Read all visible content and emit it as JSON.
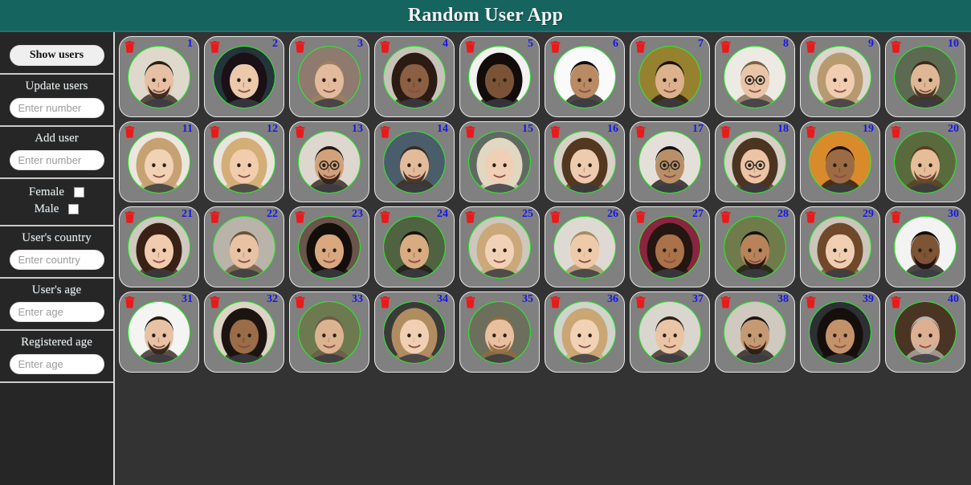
{
  "header": {
    "title": "Random User App"
  },
  "colors": {
    "header_bg": "#166460",
    "sidebar_bg": "#262626",
    "main_bg": "#333333",
    "card_bg": "#808080",
    "avatar_ring": "#18f018",
    "number": "#1616e8",
    "trash": "#e81a1a"
  },
  "sidebar": {
    "show_users_button": "Show users",
    "update_users": {
      "label": "Update users",
      "placeholder": "Enter number",
      "value": ""
    },
    "add_user": {
      "label": "Add user",
      "placeholder": "Enter number",
      "value": ""
    },
    "gender": {
      "female": {
        "label": "Female",
        "checked": false
      },
      "male": {
        "label": "Male",
        "checked": false
      }
    },
    "country": {
      "label": "User's country",
      "placeholder": "Enter country",
      "value": ""
    },
    "age": {
      "label": "User's age",
      "placeholder": "Enter age",
      "value": ""
    },
    "registered_age": {
      "label": "Registered age",
      "placeholder": "Enter age",
      "value": ""
    },
    "icons": {
      "delete": "trash-icon",
      "checkbox": "checkbox-icon"
    }
  },
  "main": {
    "columns": 10,
    "rows": 4,
    "total_users": 40,
    "users": [
      {
        "number": "1",
        "hair": "#2a1d14",
        "skin": "#e6c0a4",
        "bg": "#ded9cc",
        "facial": true,
        "glasses": false,
        "long": false
      },
      {
        "number": "2",
        "hair": "#1a1016",
        "skin": "#ecc9ab",
        "bg": "#24343a",
        "facial": false,
        "glasses": false,
        "long": true
      },
      {
        "number": "3",
        "hair": "#9e8260",
        "skin": "#e3bb9c",
        "bg": "#8e7a6e",
        "facial": false,
        "glasses": false,
        "long": false
      },
      {
        "number": "4",
        "hair": "#2b1b12",
        "skin": "#8a5f42",
        "bg": "#c8c3b8",
        "facial": false,
        "glasses": false,
        "long": true
      },
      {
        "number": "5",
        "hair": "#120d0a",
        "skin": "#7a5337",
        "bg": "#f2f2f2",
        "facial": false,
        "glasses": false,
        "long": true
      },
      {
        "number": "6",
        "hair": "#110c09",
        "skin": "#b98a63",
        "bg": "#fafafa",
        "facial": false,
        "glasses": false,
        "long": false
      },
      {
        "number": "7",
        "hair": "#1a1210",
        "skin": "#dcb18c",
        "bg": "#96812f",
        "facial": false,
        "glasses": false,
        "long": false
      },
      {
        "number": "8",
        "hair": "#7b6046",
        "skin": "#e9c4a6",
        "bg": "#eceae3",
        "facial": false,
        "glasses": true,
        "long": false
      },
      {
        "number": "9",
        "hair": "#b79a6f",
        "skin": "#f0cdb1",
        "bg": "#ddd6cf",
        "facial": false,
        "glasses": false,
        "long": true
      },
      {
        "number": "10",
        "hair": "#3a2a1c",
        "skin": "#dfb795",
        "bg": "#5c6a52",
        "facial": true,
        "glasses": false,
        "long": false
      },
      {
        "number": "11",
        "hair": "#c6a273",
        "skin": "#f2d2b5",
        "bg": "#ece6df",
        "facial": false,
        "glasses": false,
        "long": true
      },
      {
        "number": "12",
        "hair": "#d3ae76",
        "skin": "#f1cdae",
        "bg": "#e9e4dd",
        "facial": false,
        "glasses": false,
        "long": true
      },
      {
        "number": "13",
        "hair": "#231812",
        "skin": "#d2a179",
        "bg": "#ddd7cf",
        "facial": true,
        "glasses": true,
        "long": false
      },
      {
        "number": "14",
        "hair": "#3b2a1e",
        "skin": "#e2bb9a",
        "bg": "#4a5d6b",
        "facial": true,
        "glasses": false,
        "long": false
      },
      {
        "number": "15",
        "hair": "#e2d7c0",
        "skin": "#f0cfb5",
        "bg": "#5f6a62",
        "facial": false,
        "glasses": false,
        "long": true
      },
      {
        "number": "16",
        "hair": "#53371f",
        "skin": "#eecbae",
        "bg": "#d8d1c8",
        "facial": false,
        "glasses": false,
        "long": true
      },
      {
        "number": "17",
        "hair": "#130e0b",
        "skin": "#b98f67",
        "bg": "#e4e0d9",
        "facial": false,
        "glasses": true,
        "long": false
      },
      {
        "number": "18",
        "hair": "#4b3420",
        "skin": "#ecc4a4",
        "bg": "#d6d0c7",
        "facial": false,
        "glasses": true,
        "long": true
      },
      {
        "number": "19",
        "hair": "#191110",
        "skin": "#9d6b43",
        "bg": "#d98a2a",
        "facial": false,
        "glasses": false,
        "long": false
      },
      {
        "number": "20",
        "hair": "#5a3c22",
        "skin": "#e6bd99",
        "bg": "#596b3c",
        "facial": true,
        "glasses": false,
        "long": false
      },
      {
        "number": "21",
        "hair": "#3a2115",
        "skin": "#f0cbae",
        "bg": "#cfc9bf",
        "facial": false,
        "glasses": false,
        "long": true
      },
      {
        "number": "22",
        "hair": "#6a5338",
        "skin": "#e8c2a2",
        "bg": "#b9b3aa",
        "facial": false,
        "glasses": false,
        "long": false
      },
      {
        "number": "23",
        "hair": "#140e0b",
        "skin": "#d9a87f",
        "bg": "#6a544c",
        "facial": false,
        "glasses": false,
        "long": true
      },
      {
        "number": "24",
        "hair": "#171010",
        "skin": "#d9ab80",
        "bg": "#4f6340",
        "facial": false,
        "glasses": false,
        "long": false
      },
      {
        "number": "25",
        "hair": "#caa87a",
        "skin": "#f2d2b6",
        "bg": "#cdc7bd",
        "facial": false,
        "glasses": false,
        "long": true
      },
      {
        "number": "26",
        "hair": "#a78a5e",
        "skin": "#eec9aa",
        "bg": "#dedad3",
        "facial": false,
        "glasses": false,
        "long": false
      },
      {
        "number": "27",
        "hair": "#241610",
        "skin": "#a97249",
        "bg": "#8a2540",
        "facial": false,
        "glasses": false,
        "long": true
      },
      {
        "number": "28",
        "hair": "#17100c",
        "skin": "#b9835a",
        "bg": "#6f7b4a",
        "facial": true,
        "glasses": false,
        "long": false
      },
      {
        "number": "29",
        "hair": "#70492a",
        "skin": "#f0ceb2",
        "bg": "#cbc5bb",
        "facial": false,
        "glasses": false,
        "long": true
      },
      {
        "number": "30",
        "hair": "#120d0b",
        "skin": "#7d5434",
        "bg": "#f3f3f3",
        "facial": true,
        "glasses": false,
        "long": false
      },
      {
        "number": "31",
        "hair": "#241810",
        "skin": "#e8c2a4",
        "bg": "#f4f4f2",
        "facial": true,
        "glasses": false,
        "long": false
      },
      {
        "number": "32",
        "hair": "#1c1410",
        "skin": "#9a6c48",
        "bg": "#ded4c6",
        "facial": false,
        "glasses": false,
        "long": true
      },
      {
        "number": "33",
        "hair": "#6b5a44",
        "skin": "#dcb391",
        "bg": "#6d7a4f",
        "facial": false,
        "glasses": false,
        "long": false
      },
      {
        "number": "34",
        "hair": "#b08d60",
        "skin": "#f1cfb3",
        "bg": "#3a3a3a",
        "facial": false,
        "glasses": false,
        "long": true
      },
      {
        "number": "35",
        "hair": "#8e6b3e",
        "skin": "#e8c0a0",
        "bg": "#6c6f5c",
        "facial": true,
        "glasses": false,
        "long": false
      },
      {
        "number": "36",
        "hair": "#c9a673",
        "skin": "#f2d2b5",
        "bg": "#cfd4cc",
        "facial": false,
        "glasses": false,
        "long": true
      },
      {
        "number": "37",
        "hair": "#2e2015",
        "skin": "#e9c5a6",
        "bg": "#d9d6cf",
        "facial": false,
        "glasses": false,
        "long": false
      },
      {
        "number": "38",
        "hair": "#1d1410",
        "skin": "#c59a72",
        "bg": "#cfc9bf",
        "facial": true,
        "glasses": false,
        "long": false
      },
      {
        "number": "39",
        "hair": "#150f0c",
        "skin": "#c4926a",
        "bg": "#2d2f34",
        "facial": false,
        "glasses": false,
        "long": true
      },
      {
        "number": "40",
        "hair": "#b9b4ad",
        "skin": "#ddb092",
        "bg": "#4a3524",
        "facial": true,
        "glasses": false,
        "long": false
      }
    ]
  }
}
